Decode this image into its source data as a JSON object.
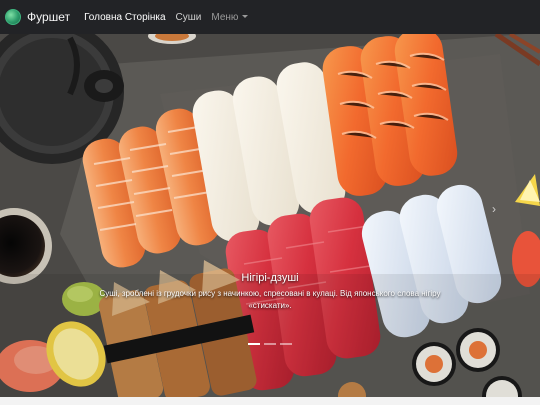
{
  "navbar": {
    "brand": "Фуршет",
    "links": [
      "Головна Сторінка",
      "Суши",
      "Меню"
    ]
  },
  "carousel": {
    "caption_title": "Нігірі-дзуші",
    "caption_text": "Суші, зроблені із грудочки рису з начинкою, спресовані в кулаці. Від японського слова нігіру «стискати».",
    "indicator_count": 3,
    "active_index": 0
  },
  "colors": {
    "navbar_bg": "#222326",
    "salmon": "#f26a2e",
    "tuna": "#d6313f",
    "shrimp": "#f08a4b"
  }
}
